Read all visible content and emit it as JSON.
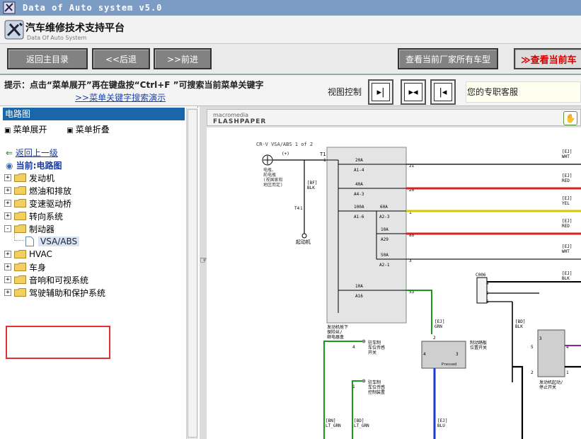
{
  "window": {
    "title": "Data of Auto system v5.0"
  },
  "header": {
    "title": "汽车维修技术支持平台",
    "subtitle": "Data Of Auto System"
  },
  "toolbar": {
    "home": "返回主目录",
    "back": "<<后退",
    "forward": ">>前进",
    "all_models": "查看当前厂家所有车型",
    "current_model": "≫查看当前车"
  },
  "hintbar": {
    "hint": "提示：点击“菜单展开”再在键盘按“Ctrl+F ”可搜索当前菜单关键字",
    "demo_link": ">>菜单关键字搜索演示",
    "view_control": "视图控制",
    "customer_service": "您的专职客服"
  },
  "leftpanel": {
    "header": "电路图",
    "expand": "菜单展开",
    "collapse": "菜单折叠",
    "back": "返回上一级",
    "current": "当前:电路图",
    "tree": [
      {
        "label": "发动机",
        "sign": "+"
      },
      {
        "label": "燃油和排放",
        "sign": "+"
      },
      {
        "label": "变速驱动桥",
        "sign": "+"
      },
      {
        "label": "转向系统",
        "sign": "+"
      },
      {
        "label": "制动器",
        "sign": "-"
      },
      {
        "label": "HVAC",
        "sign": "+"
      },
      {
        "label": "车身",
        "sign": "+"
      },
      {
        "label": "音响和可视系统",
        "sign": "+"
      },
      {
        "label": "驾驶辅助和保护系统",
        "sign": "+"
      }
    ],
    "leaf": "VSA/ABS"
  },
  "viewer": {
    "flash_brand_top": "macromedia",
    "flash_brand": "FLASHPAPER",
    "diagram": {
      "header": "CR-V VSA/ABS 1 of 2",
      "battery_plus": "(+)",
      "battery_note": "电瓶、\n前电瓶\n(视国家和\n地区而定)",
      "ground_code": "[BF]\nBLK",
      "ground_t4": "T4",
      "ground_1": "1",
      "ground_label": "起动机",
      "t1": "T1",
      "pin_1": "1",
      "fuses": [
        {
          "rating": "20A",
          "id": "A1-4",
          "pin": "21"
        },
        {
          "rating": "40A",
          "id": "A4-3",
          "pin": "20"
        },
        {
          "rating": "100A",
          "id": "A1-6",
          "pin": "1"
        },
        {
          "rating": "60A",
          "id": "A2-3",
          "pin": ""
        },
        {
          "rating": "10A",
          "id": "A29",
          "pin": "80"
        },
        {
          "rating": "50A",
          "id": "A2-1",
          "pin": "3"
        },
        {
          "rating": "10A",
          "id": "A16",
          "pin": "53"
        }
      ],
      "fuse_box_label": "发动机舱下\n保险丝/\n继电器盒",
      "wires_right": [
        {
          "code": "[EJ]",
          "color": "WHT"
        },
        {
          "code": "[EJ]",
          "color": "RED"
        },
        {
          "code": "[EJ]",
          "color": "YEL"
        },
        {
          "code": "[EJ]",
          "color": "RED"
        },
        {
          "code": "[EJ]",
          "color": "WHT"
        },
        {
          "code": "[EJ]",
          "color": "BLK"
        }
      ],
      "c006": "C006",
      "c006_pins": [
        "4",
        "5",
        "6"
      ],
      "grn_wire": "[EJ]\nGRN",
      "brake_switch": "制动踏板\n位置开关",
      "brake_pins": [
        "2",
        "4",
        "3",
        "1"
      ],
      "brake_pressed": "Pressed",
      "parking_upper": "驻车制\n车位传感\n开关",
      "parking_upper_pin": "4",
      "parking_lower": "驻车制\n车位传感\n控制装置",
      "parking_lower_pin": "1",
      "bottom_codes": [
        "[BN]\nLT_GRN",
        "[BD]\nLT_GRN",
        "[EJ]\nBLU"
      ],
      "ign_code": "[BD]\nBLK",
      "ign_switch": "发动机起动/\n停止开关",
      "ign_pins": [
        "5",
        "3",
        "4",
        "1",
        "2",
        "6"
      ]
    }
  },
  "colors": {
    "titlebar": "#7b9cc4",
    "panel_header": "#1a66a8",
    "highlight": "#e03030"
  }
}
